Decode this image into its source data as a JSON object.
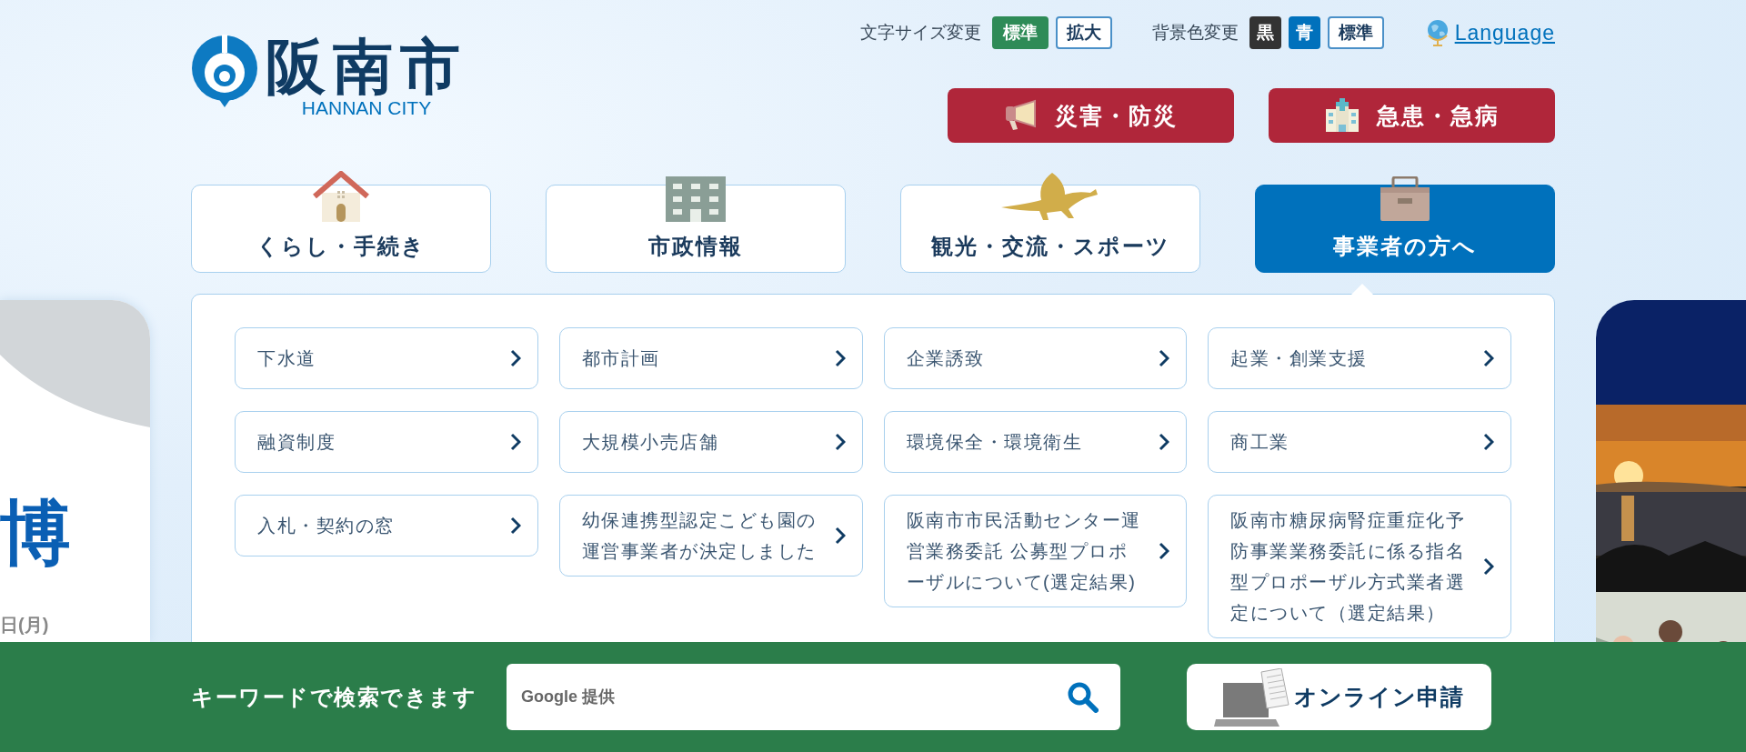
{
  "logo": {
    "name": "阪南市",
    "sub": "HANNAN CITY"
  },
  "font_size": {
    "label": "文字サイズ変更",
    "options": [
      {
        "label": "標準",
        "selected": true
      },
      {
        "label": "拡大",
        "selected": false
      }
    ]
  },
  "bg_color": {
    "label": "背景色変更",
    "options": [
      {
        "label": "黒",
        "kind": "black"
      },
      {
        "label": "青",
        "kind": "blue"
      },
      {
        "label": "標準",
        "kind": "standard"
      }
    ]
  },
  "language": "Language",
  "emergency": [
    {
      "label": "災害・防災",
      "kind": "megaphone"
    },
    {
      "label": "急患・急病",
      "kind": "hospital"
    }
  ],
  "nav": [
    {
      "label": "くらし・手続き",
      "kind": "house",
      "selected": false
    },
    {
      "label": "市政情報",
      "kind": "building",
      "selected": false
    },
    {
      "label": "観光・交流・スポーツ",
      "kind": "dinosaur",
      "selected": false
    },
    {
      "label": "事業者の方へ",
      "kind": "briefcase",
      "selected": true
    }
  ],
  "menu": [
    "下水道",
    "都市計画",
    "企業誘致",
    "起業・創業支援",
    "融資制度",
    "大規模小売店舗",
    "環境保全・環境衛生",
    "商工業",
    "入札・契約の窓",
    "幼保連携型認定こども園の運営事業者が決定しました",
    "阪南市市民活動センター運営業務委託 公募型プロポーザルについて(選定結果)",
    "阪南市糖尿病腎症重症化予防事業業務委託に係る指名型プロポーザル方式業者選定について（選定結果）"
  ],
  "left_banner": {
    "title": "博",
    "date": "日(月)"
  },
  "search_bar": {
    "label": "キーワードで検索できます",
    "placeholder": "Google 提供"
  },
  "online": "オンライン申請"
}
